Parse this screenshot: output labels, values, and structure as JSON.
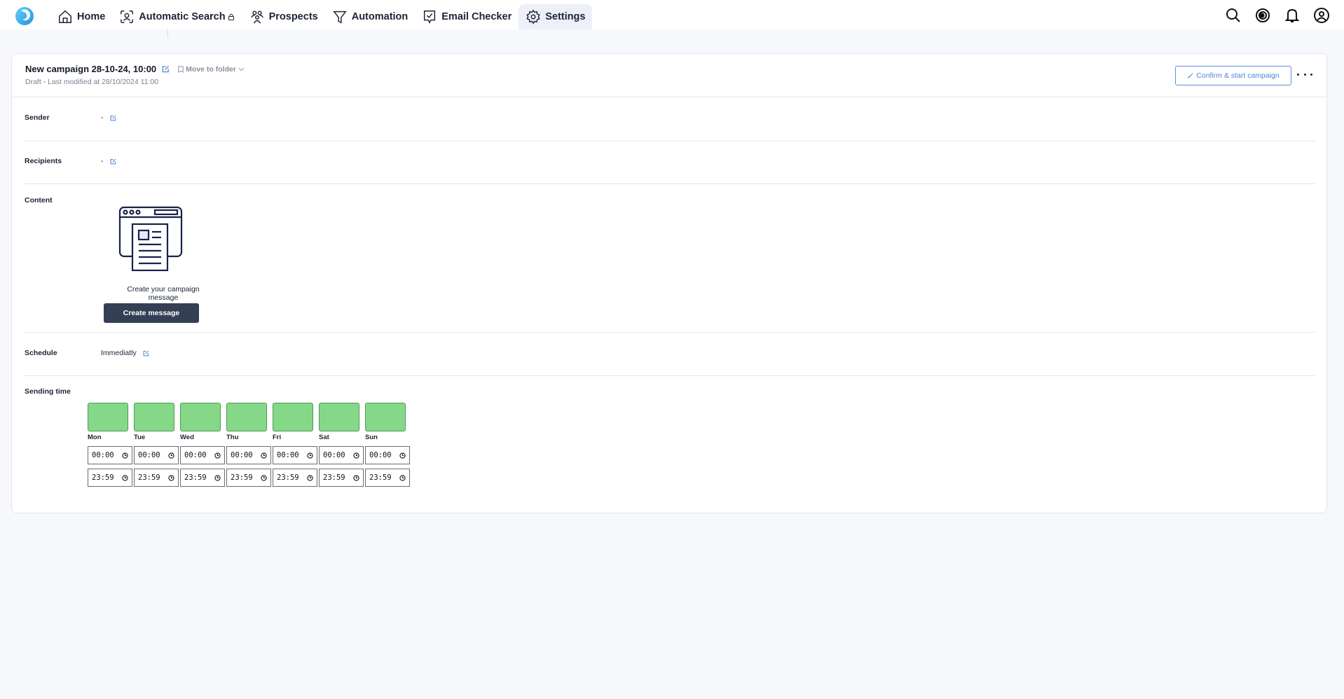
{
  "nav": {
    "items": [
      {
        "label": "Home",
        "icon": "home-icon"
      },
      {
        "label": "Automatic Search",
        "icon": "face-scan-icon",
        "locked": true
      },
      {
        "label": "Prospects",
        "icon": "users-icon"
      },
      {
        "label": "Automation",
        "icon": "filter-icon"
      },
      {
        "label": "Email Checker",
        "icon": "email-check-icon"
      },
      {
        "label": "Settings",
        "icon": "gear-icon",
        "active": true
      }
    ],
    "right_icons": [
      "search-icon",
      "credits-icon",
      "bell-icon",
      "user-icon"
    ]
  },
  "campaign": {
    "title": "New campaign 28-10-24, 10:00",
    "move_to_folder": "Move to folder",
    "subtitle": "Draft - Last modified at 28/10/2024 11:00",
    "confirm_label": "Confirm & start campaign"
  },
  "sections": {
    "sender": {
      "label": "Sender",
      "value": "-"
    },
    "recipients": {
      "label": "Recipients",
      "value": "-"
    },
    "content": {
      "label": "Content",
      "caption": "Create your campaign message",
      "button": "Create message"
    },
    "schedule": {
      "label": "Schedule",
      "value": "Immediatly"
    },
    "sending_time": {
      "label": "Sending time"
    }
  },
  "colors": {
    "accent": "#4f83d9",
    "day_enabled": "#85d888",
    "primary_button": "#343f55"
  },
  "sending_days": [
    {
      "day": "Mon",
      "enabled": true,
      "start": "00:00",
      "end": "23:59"
    },
    {
      "day": "Tue",
      "enabled": true,
      "start": "00:00",
      "end": "23:59"
    },
    {
      "day": "Wed",
      "enabled": true,
      "start": "00:00",
      "end": "23:59"
    },
    {
      "day": "Thu",
      "enabled": true,
      "start": "00:00",
      "end": "23:59"
    },
    {
      "day": "Fri",
      "enabled": true,
      "start": "00:00",
      "end": "23:59"
    },
    {
      "day": "Sat",
      "enabled": true,
      "start": "00:00",
      "end": "23:59"
    },
    {
      "day": "Sun",
      "enabled": true,
      "start": "00:00",
      "end": "23:59"
    }
  ]
}
